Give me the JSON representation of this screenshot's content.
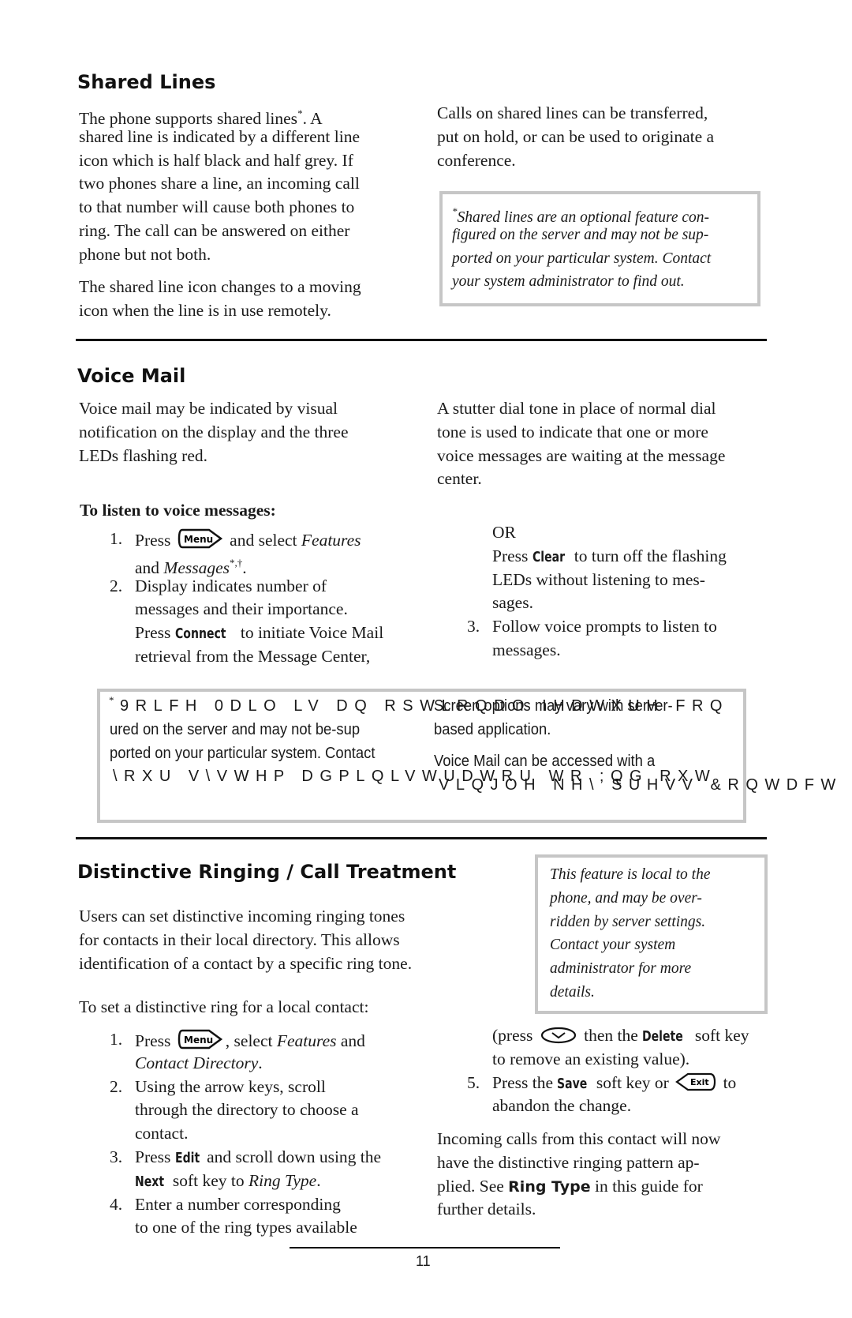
{
  "shared_lines": {
    "heading": "Shared Lines",
    "left": [
      [
        [
          "The phone supports shared lines",
          ""
        ],
        [
          "*",
          "sup"
        ],
        [
          ".  A",
          ""
        ]
      ],
      [
        [
          "shared line is indicated by a different line",
          ""
        ]
      ],
      [
        [
          "icon which is half black and half grey.  If",
          ""
        ]
      ],
      [
        [
          "two phones share a line, an incoming call",
          ""
        ]
      ],
      [
        [
          "to that number will cause both phones to",
          ""
        ]
      ],
      [
        [
          "ring.  The call can be answered on either",
          ""
        ]
      ],
      [
        [
          "phone but not both.",
          ""
        ]
      ]
    ],
    "left2": [
      [
        [
          "The shared line icon changes to a moving",
          ""
        ]
      ],
      [
        [
          "icon when the line is in use remotely.",
          ""
        ]
      ]
    ],
    "right": [
      [
        [
          "Calls on shared lines can be transferred,",
          ""
        ]
      ],
      [
        [
          "put on hold, or can be used to originate a",
          ""
        ]
      ],
      [
        [
          "conference.",
          ""
        ]
      ]
    ],
    "note": [
      [
        [
          "*",
          "sup"
        ],
        [
          "Shared lines are an optional feature con-",
          ""
        ]
      ],
      [
        [
          "figured on the server and may not be sup-",
          ""
        ]
      ],
      [
        [
          "ported on your particular system.  Contact",
          ""
        ]
      ],
      [
        [
          "your system administrator to find out.",
          ""
        ]
      ]
    ]
  },
  "voice_mail": {
    "heading": "Voice Mail",
    "left": [
      [
        [
          "Voice mail may be indicated by visual",
          ""
        ]
      ],
      [
        [
          "notification on the display and the three",
          ""
        ]
      ],
      [
        [
          "LEDs flashing red.",
          ""
        ]
      ]
    ],
    "right": [
      [
        [
          "A stutter dial tone in place of normal dial",
          ""
        ]
      ],
      [
        [
          "tone is used to indicate that one or more",
          ""
        ]
      ],
      [
        [
          "voice messages are waiting at the message",
          ""
        ]
      ],
      [
        [
          "center.",
          ""
        ]
      ]
    ],
    "subheading": "To listen to voice messages:",
    "steps_left": [
      [
        [
          "1.",
          "num"
        ],
        [
          "Press ",
          ""
        ],
        [
          "menu-button-icon",
          "icon"
        ],
        [
          " and select ",
          ""
        ],
        [
          "Features",
          "i"
        ]
      ],
      [
        [
          "and ",
          ""
        ],
        [
          "Messages",
          "i"
        ],
        [
          "*,†",
          "sup"
        ],
        [
          ".",
          ""
        ]
      ],
      [
        [
          "2.",
          "num"
        ],
        [
          "Display indicates number of",
          ""
        ]
      ],
      [
        [
          "messages and their importance.",
          ""
        ]
      ],
      [
        [
          "Press ",
          ""
        ],
        [
          "Connect",
          "k"
        ],
        [
          " to initiate Voice Mail",
          ""
        ]
      ],
      [
        [
          "retrieval from the Message Center,",
          ""
        ]
      ]
    ],
    "steps_right": [
      [
        [
          "OR",
          ""
        ]
      ],
      [
        [
          "Press ",
          ""
        ],
        [
          "Clear",
          "k"
        ],
        [
          " to turn off the flashing",
          ""
        ]
      ],
      [
        [
          "LEDs without listening to mes-",
          ""
        ]
      ],
      [
        [
          "sages.",
          ""
        ]
      ],
      [
        [
          "3.",
          "num"
        ],
        [
          "Follow voice prompts to listen to",
          ""
        ]
      ],
      [
        [
          "messages.",
          ""
        ]
      ]
    ],
    "footnote": {
      "asterisk": "*",
      "garbled_line1": "9RLFH 0DLO LV DQ RSWLRQDO IHDWXUH FRQ",
      "line2": "ured on the server and may not be-sup",
      "line3": "ported on your particular system.  Contact",
      "garbled_line4": "\\RXU V\\VWHP DGPLQLVWUDWRU WR ;QG RXW",
      "col2_line1": "Screen options may vary with server-",
      "col2_line2": "based application.",
      "col2_line3": "Voice Mail can be accessed with a",
      "garbled_col2_line4": "VLQJOH NH\\ SUHVV  &RQWDFW \\"
    }
  },
  "distinctive": {
    "heading": "Distinctive Ringing / Call Treatment",
    "note": [
      [
        [
          "This feature is local to the",
          ""
        ]
      ],
      [
        [
          "phone, and may be over-",
          ""
        ]
      ],
      [
        [
          "ridden by server settings.",
          ""
        ]
      ],
      [
        [
          "Contact your system",
          ""
        ]
      ],
      [
        [
          "administrator for more",
          ""
        ]
      ],
      [
        [
          "details.",
          ""
        ]
      ]
    ],
    "intro": [
      [
        [
          "Users can set distinctive incoming ringing tones",
          ""
        ]
      ],
      [
        [
          "for contacts in their local directory.  This allows",
          ""
        ]
      ],
      [
        [
          "identification of a contact by a specific ring tone.",
          ""
        ]
      ]
    ],
    "to_set": "To set a distinctive ring for a local contact:",
    "steps_left": [
      [
        [
          "1.",
          "num"
        ],
        [
          "Press ",
          ""
        ],
        [
          "menu-button-icon",
          "icon"
        ],
        [
          ", select ",
          ""
        ],
        [
          "Features",
          "i"
        ],
        [
          " and",
          ""
        ]
      ],
      [
        [
          "Contact Directory",
          "i"
        ],
        [
          ".",
          ""
        ]
      ],
      [
        [
          "2.",
          "num"
        ],
        [
          "Using the arrow keys, scroll",
          ""
        ]
      ],
      [
        [
          "through the directory to choose a",
          ""
        ]
      ],
      [
        [
          "contact.",
          ""
        ]
      ],
      [
        [
          "3.",
          "num"
        ],
        [
          "Press ",
          ""
        ],
        [
          "Edit",
          "k"
        ],
        [
          " and scroll down using the",
          ""
        ]
      ],
      [
        [
          "Next",
          "k"
        ],
        [
          " soft key to ",
          ""
        ],
        [
          "Ring Type",
          "i"
        ],
        [
          ".",
          ""
        ]
      ],
      [
        [
          "4.",
          "num"
        ],
        [
          "Enter a number corresponding",
          ""
        ]
      ],
      [
        [
          "to one of the ring types available",
          ""
        ]
      ]
    ],
    "steps_right": [
      [
        [
          "(press ",
          ""
        ],
        [
          "select-button-icon",
          "icon"
        ],
        [
          " then the ",
          ""
        ],
        [
          "Delete",
          "k"
        ],
        [
          " soft key",
          ""
        ]
      ],
      [
        [
          "to remove an existing value).",
          ""
        ]
      ],
      [
        [
          "5.",
          "num"
        ],
        [
          "Press the ",
          ""
        ],
        [
          "Save",
          "k"
        ],
        [
          " soft key or ",
          ""
        ],
        [
          "exit-button-icon",
          "icon"
        ],
        [
          " to",
          ""
        ]
      ],
      [
        [
          "abandon the change.",
          ""
        ]
      ]
    ],
    "outro": [
      [
        [
          "Incoming calls from this contact will now",
          ""
        ]
      ],
      [
        [
          "have the distinctive ringing pattern ap-",
          ""
        ]
      ],
      [
        [
          "plied.  See ",
          ""
        ],
        [
          "Ring Type",
          "rt"
        ],
        [
          " in this guide for",
          ""
        ]
      ],
      [
        [
          "further details.",
          ""
        ]
      ]
    ]
  },
  "page_number": "11"
}
